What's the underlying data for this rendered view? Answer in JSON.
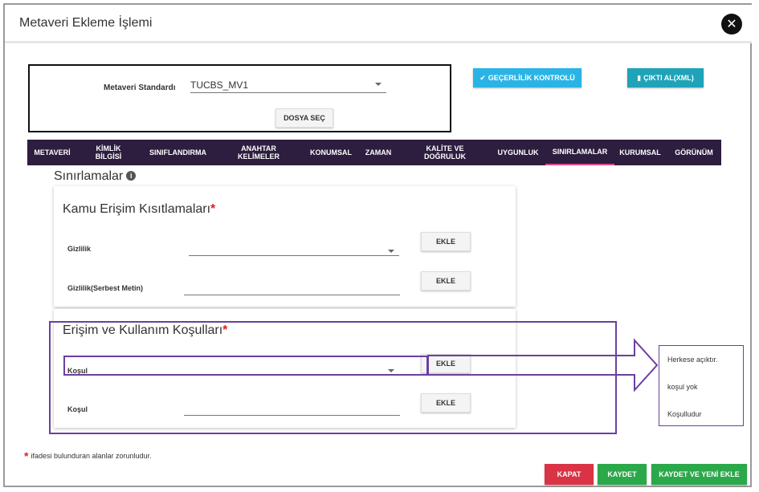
{
  "header": {
    "title": "Metaveri Ekleme İşlemi"
  },
  "standard": {
    "label": "Metaveri Standardı",
    "selected": "TUCBS_MV1",
    "file_button": "DOSYA SEÇ"
  },
  "actions": {
    "validate": "GEÇERLİLİK KONTROLÜ",
    "export_xml": "ÇIKTI AL(XML)"
  },
  "tabs": [
    {
      "label": "METAVERİ"
    },
    {
      "label": "KİMLİK BİLGİSİ"
    },
    {
      "label": "SINIFLANDIRMA"
    },
    {
      "label": "ANAHTAR KELİMELER"
    },
    {
      "label": "KONUMSAL"
    },
    {
      "label": "ZAMAN"
    },
    {
      "label": "KALİTE VE DOĞRULUK"
    },
    {
      "label": "UYGUNLUK"
    },
    {
      "label": "SINIRLAMALAR"
    },
    {
      "label": "KURUMSAL"
    },
    {
      "label": "GÖRÜNÜM"
    }
  ],
  "section": {
    "title": "Sınırlamalar",
    "info_glyph": "i"
  },
  "public_access": {
    "title": "Kamu Erişim Kısıtlamaları",
    "fields": [
      {
        "label": "Gizlilik",
        "button": "EKLE"
      },
      {
        "label": "Gizlilik(Serbest Metin)",
        "button": "EKLE"
      }
    ]
  },
  "usage_terms": {
    "title": "Erişim ve Kullanım Koşulları",
    "fields": [
      {
        "label": "Koşul",
        "button": "EKLE"
      },
      {
        "label": "Koşul",
        "button": "EKLE"
      }
    ]
  },
  "dropdown_options": [
    "Herkese açıktır.",
    "koşul yok",
    "Koşulludur"
  ],
  "required_mark": "*",
  "footnote": "ifadesi bulunduran alanlar zorunludur.",
  "footer": {
    "close": "KAPAT",
    "save": "KAYDET",
    "save_new": "KAYDET VE YENİ EKLE"
  },
  "colors": {
    "tab_bar": "#2d1d3f",
    "tab_active_underline": "#e04a8a",
    "annotation": "#6b3fa0",
    "danger": "#d93345",
    "success": "#2aa84a",
    "info": "#2ab4e6"
  }
}
